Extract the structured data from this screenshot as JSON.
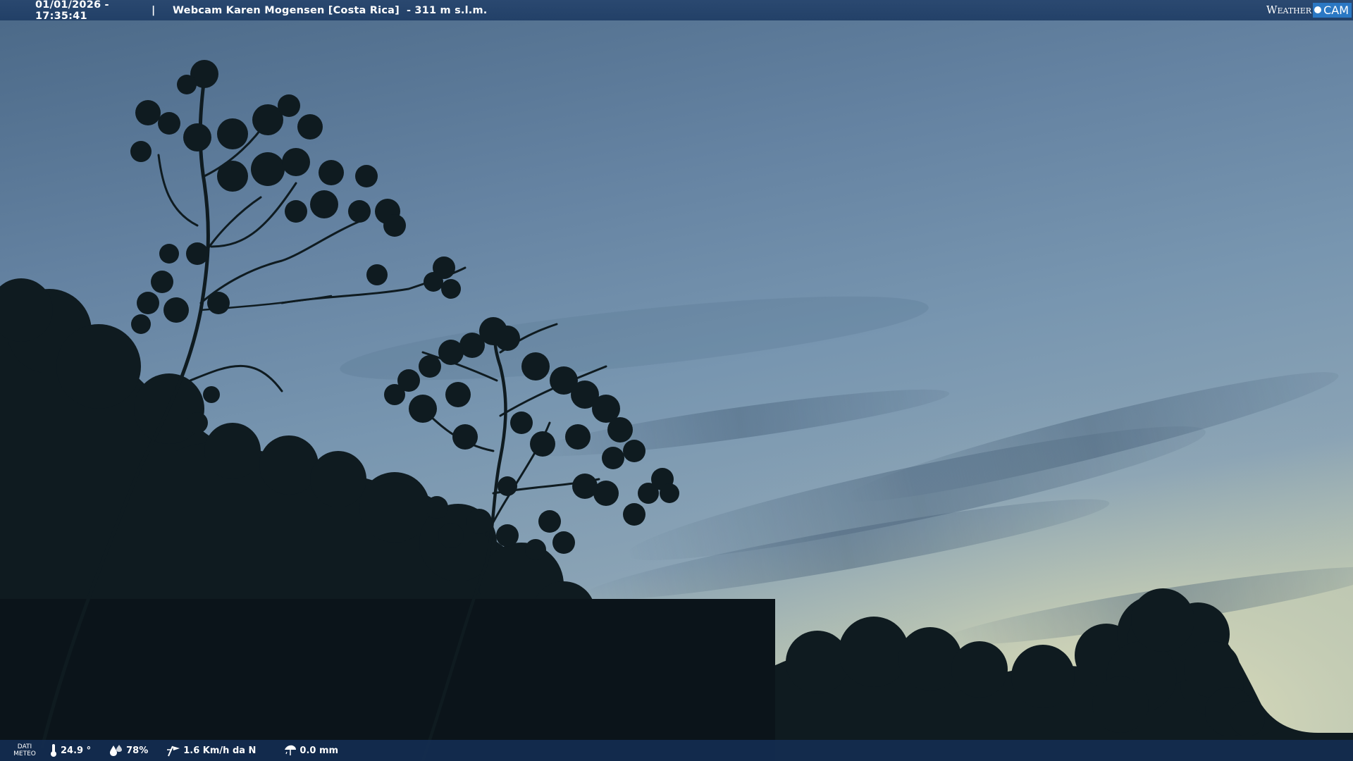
{
  "overlay_top": {
    "datetime": "01/01/2026 - 17:35:41",
    "separator": "|",
    "title": "Webcam Karen Mogensen [Costa Rica]",
    "altitude": "- 311 m s.l.m."
  },
  "brand": {
    "weather": "Weather",
    "cam": "CAM"
  },
  "overlay_bottom": {
    "label_line1": "DATI",
    "label_line2": "METEO",
    "temperature": "24.9 °",
    "humidity": "78%",
    "wind": "1.6 Km/h da N",
    "rain": "0.0 mm"
  },
  "colors": {
    "sky_top": "#4e6f8f",
    "sky_mid": "#7090ae",
    "sky_horizon": "#c9d2b8",
    "vegetation": "#0f1b20",
    "bar": "#1e3c64",
    "brand_accent": "#2b78c4"
  },
  "icons": {
    "temperature": "thermometer-icon",
    "humidity": "humidity-drops-icon",
    "wind": "wind-vane-icon",
    "rain": "rain-gauge-icon"
  }
}
